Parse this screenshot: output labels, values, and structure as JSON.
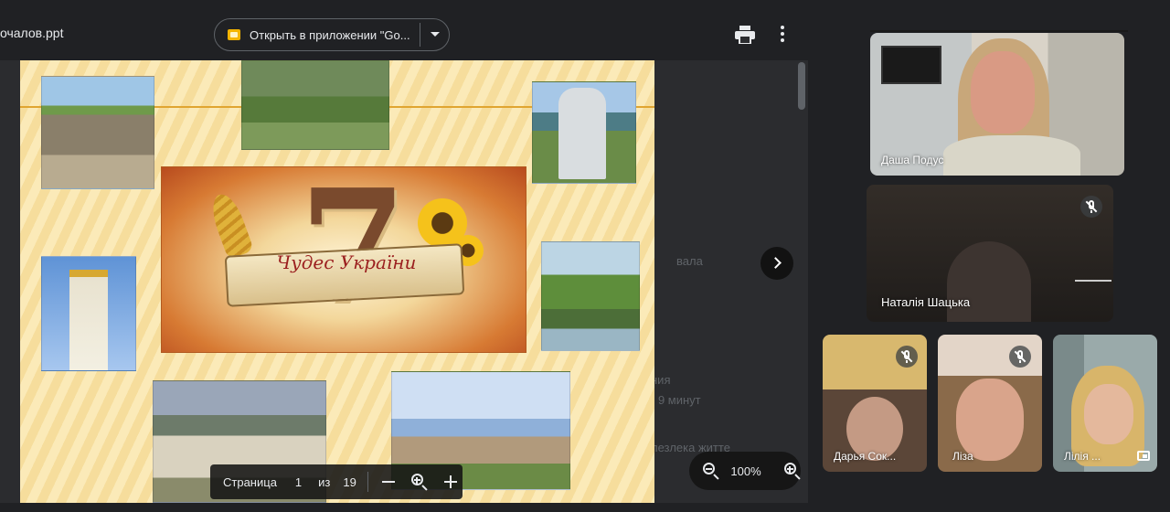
{
  "viewer": {
    "file_name": "очалов.ppt",
    "open_in_app_label": "Открыть в приложении \"Go...",
    "background_fragments": [
      "вала",
      "ния",
      "- 9 минут",
      "лезлека житте"
    ],
    "page_control": {
      "label": "Страница",
      "current_page": "1",
      "of_label": "из",
      "total_pages": "19"
    },
    "zoom": {
      "percent": "100%"
    }
  },
  "slide": {
    "title": "Чудес України"
  },
  "participants": [
    {
      "name": "Даша Подус",
      "muted": false
    },
    {
      "name": "Наталія Шацька",
      "muted": true
    },
    {
      "name": "Дарья Сок...",
      "muted": true
    },
    {
      "name": "Ліза",
      "muted": true
    },
    {
      "name": "Лілія ...",
      "muted": false
    }
  ],
  "icons": [
    "slides-icon",
    "caret-down-icon",
    "print-icon",
    "more-vert-icon",
    "chevron-right-icon",
    "zoom-out-icon",
    "zoom-in-icon",
    "minus-icon",
    "plus-icon",
    "mic-off-icon",
    "pip-icon"
  ],
  "colors": {
    "background": "#202124",
    "viewer": "#2b2c2f",
    "slides_icon": "#f4b400",
    "slide_title": "#9b1f1f"
  }
}
